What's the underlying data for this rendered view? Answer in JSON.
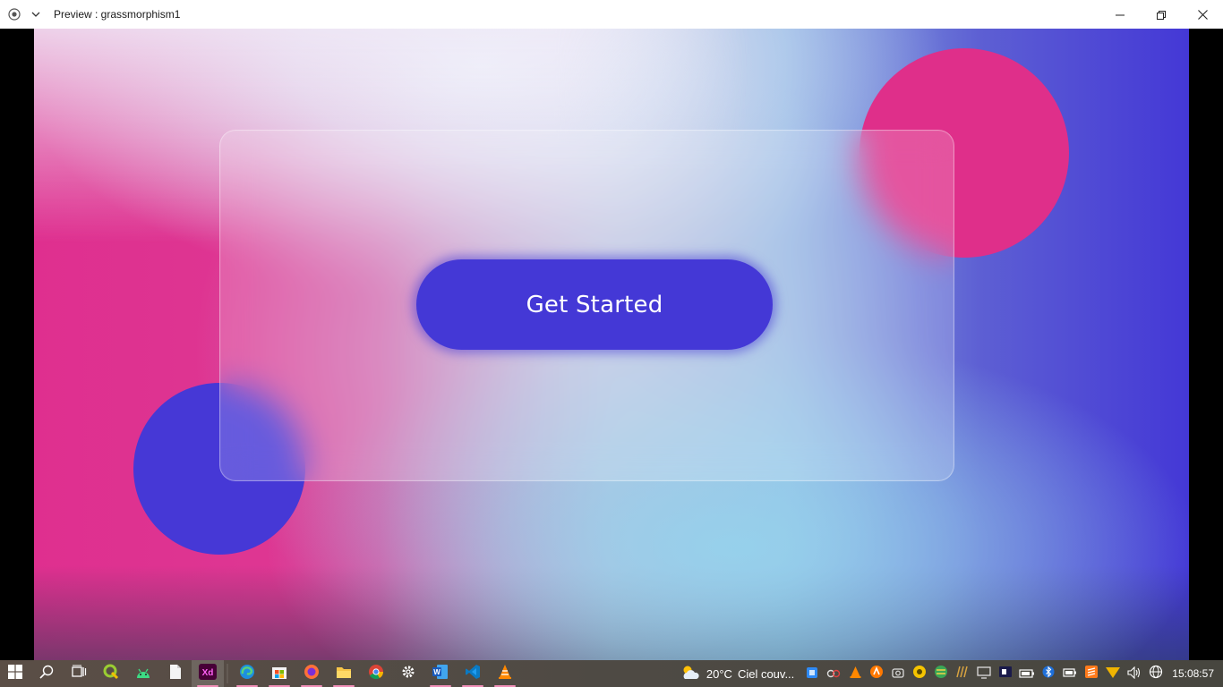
{
  "window": {
    "title": "Preview : grassmorphism1",
    "controls": {
      "minimize": "minimize-icon",
      "restore": "restore-icon",
      "close": "close-icon"
    }
  },
  "artboard": {
    "button_label": "Get Started",
    "colors": {
      "pink": "#df2f8a",
      "blue": "#4438d6",
      "light": "#e8f0fa",
      "cyan": "#96d2ec"
    }
  },
  "taskbar": {
    "apps": [
      {
        "name": "search-icon"
      },
      {
        "name": "task-view-icon"
      },
      {
        "name": "qgis-icon"
      },
      {
        "name": "android-studio-icon"
      },
      {
        "name": "file-icon"
      },
      {
        "name": "adobe-xd-icon",
        "label": "Xd"
      },
      {
        "name": "edge-icon"
      },
      {
        "name": "microsoft-store-icon"
      },
      {
        "name": "firefox-icon"
      },
      {
        "name": "file-explorer-icon"
      },
      {
        "name": "chrome-icon"
      },
      {
        "name": "settings-icon"
      },
      {
        "name": "word-icon",
        "label": "W"
      },
      {
        "name": "vscode-icon"
      },
      {
        "name": "vlc-icon"
      }
    ],
    "weather": {
      "temperature": "20°C",
      "condition": "Ciel couv..."
    },
    "clock": "15:08:57"
  }
}
